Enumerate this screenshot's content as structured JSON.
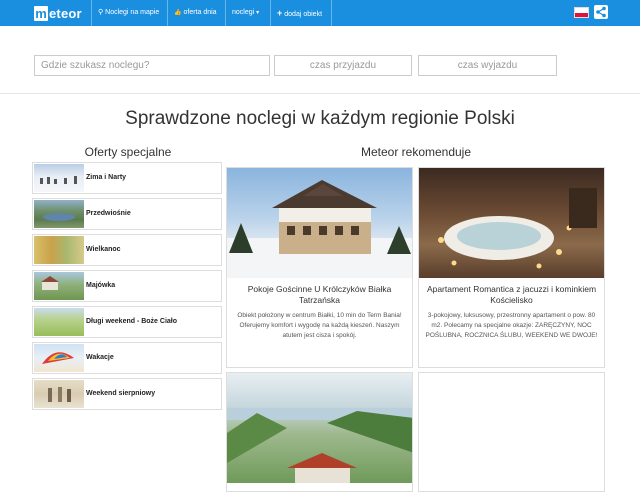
{
  "nav": {
    "logo_m": "m",
    "logo_rest": "eteor",
    "items": [
      {
        "icon": "map-marker-icon",
        "glyph": "⚲",
        "label": "Noclegi na mapie"
      },
      {
        "icon": "thumbs-up-icon",
        "glyph": "👍",
        "label": "oferta dnia"
      },
      {
        "icon": "",
        "glyph": "",
        "label": "noclegi"
      },
      {
        "icon": "plus-icon",
        "glyph": "+",
        "label": "dodaj obiekt"
      }
    ],
    "dropdown_caret": "▾",
    "language": "pl"
  },
  "search": {
    "placeholder": "Gdzie szukasz noclegu?",
    "checkin_placeholder": "czas przyjazdu",
    "checkout_placeholder": "czas wyjazdu"
  },
  "headline": "Sprawdzone noclegi w każdym regionie Polski",
  "offers": {
    "heading": "Oferty specjalne",
    "items": [
      {
        "label": "Zima i Narty"
      },
      {
        "label": "Przedwiośnie"
      },
      {
        "label": "Wielkanoc"
      },
      {
        "label": "Majówka"
      },
      {
        "label": "Długi weekend - Boże Ciało"
      },
      {
        "label": "Wakacje"
      },
      {
        "label": "Weekend sierpniowy"
      }
    ]
  },
  "recommend": {
    "heading": "Meteor rekomenduje",
    "cards": [
      {
        "title": "Pokoje Gościnne U Królczyków Białka Tatrzańska",
        "desc": "Obiekt położony w centrum Białki, 10 min do Term Bania! Oferujemy komfort i wygodę na każdą kieszeń. Naszym atutem jest cisza i spokój."
      },
      {
        "title": "Apartament Romantica z jacuzzi i kominkiem Kościelisko",
        "desc": "3-pokojowy, luksusowy, przestronny apartament o pow. 80 m2. Polecamy na specjalne okazje: ZARĘCZYNY, NOC POŚLUBNA, ROCZNICA ŚLUBU, WEEKEND WE DWOJE!"
      }
    ]
  },
  "colors": {
    "brand": "#1a8fe0",
    "flag_red": "#dc143c"
  }
}
